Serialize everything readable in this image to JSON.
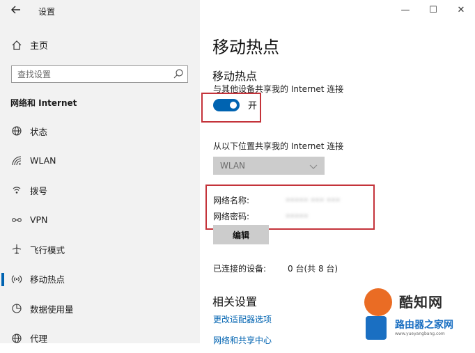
{
  "window": {
    "title": "设置",
    "back_icon": "back-arrow-icon",
    "controls": {
      "minimize": "—",
      "maximize": "☐",
      "close": "✕"
    }
  },
  "sidebar": {
    "home_label": "主页",
    "search_placeholder": "查找设置",
    "section_heading": "网络和 Internet",
    "items": [
      {
        "label": "状态",
        "icon": "globe-icon"
      },
      {
        "label": "WLAN",
        "icon": "wifi-icon"
      },
      {
        "label": "拨号",
        "icon": "dialup-icon"
      },
      {
        "label": "VPN",
        "icon": "vpn-icon"
      },
      {
        "label": "飞行模式",
        "icon": "airplane-icon"
      },
      {
        "label": "移动热点",
        "icon": "hotspot-icon",
        "active": true
      },
      {
        "label": "数据使用量",
        "icon": "data-usage-icon"
      },
      {
        "label": "代理",
        "icon": "proxy-globe-icon"
      }
    ]
  },
  "main": {
    "page_title": "移动热点",
    "sub_title": "移动热点",
    "share_description": "与其他设备共享我的 Internet 连接",
    "toggle": {
      "state": "on",
      "label": "开"
    },
    "share_from_label": "从以下位置共享我的 Internet 连接",
    "share_from_value": "WLAN",
    "network_name_label": "网络名称:",
    "network_name_value": "••••• ••• •••",
    "network_password_label": "网络密码:",
    "network_password_value": "•••••",
    "edit_button": "编辑",
    "connected_label": "已连接的设备:",
    "connected_value": "0 台(共 8 台)",
    "related_heading": "相关设置",
    "links": [
      "更改适配器选项",
      "网络和共享中心"
    ]
  },
  "watermark": {
    "text": "酷知网",
    "text2": "路由器之家网",
    "url": "www.yueyangbang.com"
  },
  "colors": {
    "accent": "#0063b1",
    "highlight_border": "#c4333a",
    "sidebar_bg": "#f2f2f2",
    "disabled_bg": "#cccccc"
  }
}
